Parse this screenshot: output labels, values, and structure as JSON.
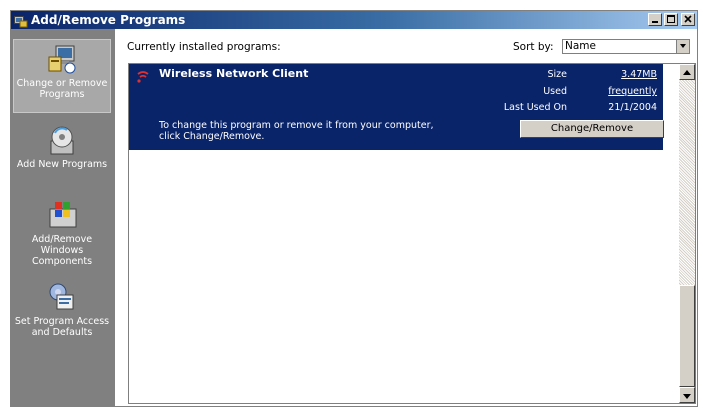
{
  "window": {
    "title": "Add/Remove Programs",
    "icon": "add-remove-programs-icon",
    "controls": [
      "minimize",
      "maximize",
      "close"
    ]
  },
  "sidebar": {
    "items": [
      {
        "label": "Change or Remove Programs",
        "icon": "change-remove-programs-icon",
        "selected": true
      },
      {
        "label": "Add New Programs",
        "icon": "add-new-programs-icon",
        "selected": false
      },
      {
        "label": "Add/Remove Windows Components",
        "icon": "windows-components-icon",
        "selected": false
      },
      {
        "label": "Set Program Access and Defaults",
        "icon": "program-access-defaults-icon",
        "selected": false
      }
    ]
  },
  "main": {
    "header": "Currently installed programs:",
    "sort_label": "Sort by:",
    "sort_value": "Name"
  },
  "programs": [
    {
      "name": "Wireless Network Client",
      "size_label": "Size",
      "size_value": "3.47MB",
      "used_label": "Used",
      "used_value": "frequently",
      "last_used_label": "Last Used On",
      "last_used_value": "21/1/2004",
      "description": "To change this program or remove it from your computer, click Change/Remove.",
      "button_label": "Change/Remove"
    }
  ],
  "colors": {
    "selection": "#0a246a",
    "sidebar": "#808080",
    "face": "#d4d0c8"
  }
}
